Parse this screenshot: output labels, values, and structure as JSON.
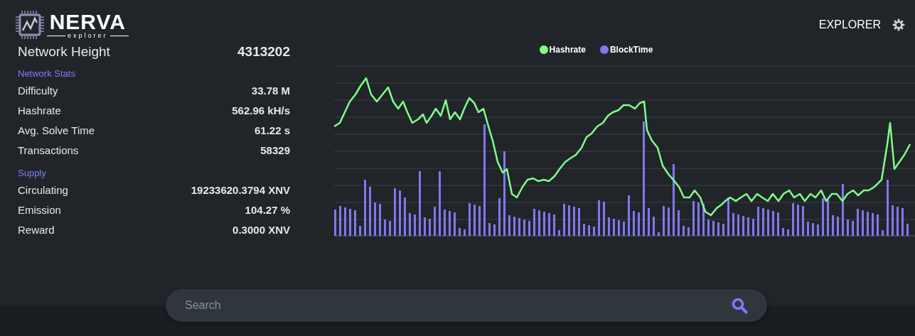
{
  "logo": {
    "name": "NERVA",
    "tagline": "explorer"
  },
  "nav": {
    "link": "EXPLORER"
  },
  "network_height": {
    "label": "Network Height",
    "value": "4313202"
  },
  "sections": [
    {
      "title": "Network Stats",
      "rows": [
        {
          "label": "Difficulty",
          "value": "33.78 M"
        },
        {
          "label": "Hashrate",
          "value": "562.96 kH/s"
        },
        {
          "label": "Avg. Solve Time",
          "value": "61.22 s"
        },
        {
          "label": "Transactions",
          "value": "58329"
        }
      ]
    },
    {
      "title": "Supply",
      "rows": [
        {
          "label": "Circulating",
          "value": "19233620.3794 XNV"
        },
        {
          "label": "Emission",
          "value": "104.27 %"
        },
        {
          "label": "Reward",
          "value": "0.3000 XNV"
        }
      ]
    }
  ],
  "chart": {
    "legend": [
      {
        "label": "Hashrate",
        "color": "#80ff8a"
      },
      {
        "label": "BlockTime",
        "color": "#8078f0"
      }
    ]
  },
  "search": {
    "placeholder": "Search"
  }
}
